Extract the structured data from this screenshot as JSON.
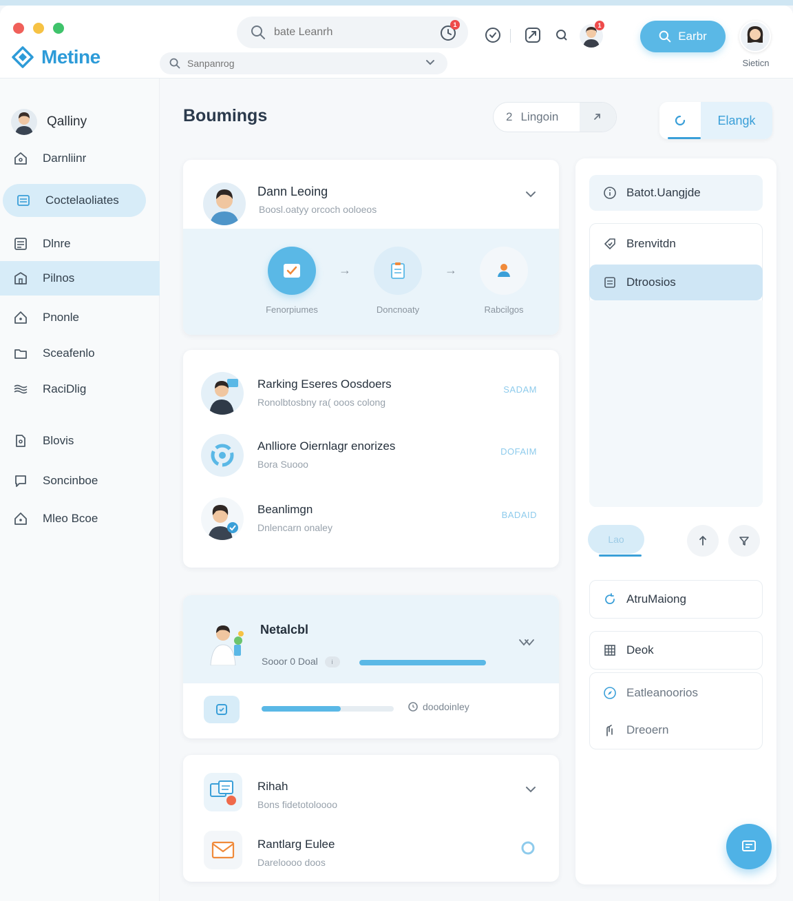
{
  "app": {
    "logo_text": "Metine",
    "accent": "#5ab8e6",
    "accent_dark": "#3a9fd8"
  },
  "header": {
    "search_placeholder": "bate Leanrh",
    "sub_search_placeholder": "Sanpanrog",
    "notification_count": "1",
    "avatar_badge_count": "1",
    "search_button_label": "Earbr",
    "user_name": "Sieticn"
  },
  "sidebar": {
    "profile_name": "Qalliny",
    "items": [
      {
        "label": "Darnliinr",
        "icon": "home-icon"
      },
      {
        "label": "Coctelaoliates",
        "icon": "list-icon"
      },
      {
        "label": "Dlnre",
        "icon": "document-icon"
      },
      {
        "label": "Pilnos",
        "icon": "building-icon"
      },
      {
        "label": "Pnonle",
        "icon": "house-icon"
      },
      {
        "label": "Sceafenlo",
        "icon": "folder-icon"
      },
      {
        "label": "RaciDlig",
        "icon": "waves-icon"
      },
      {
        "label": "Blovis",
        "icon": "file-icon"
      },
      {
        "label": "Soncinboe",
        "icon": "chat-icon"
      },
      {
        "label": "Mleo Bcoe",
        "icon": "house-icon"
      }
    ]
  },
  "main": {
    "title": "Boumings",
    "segment": {
      "count": "2",
      "label": "Lingoin"
    },
    "tab_toggle_label": "Elangk",
    "profile_card": {
      "title": "Dann Leoing",
      "subtitle": "Boosl.oatyy orcoch ooloeos",
      "steps": [
        {
          "label": "Fenorpiumes"
        },
        {
          "label": "Doncnoaty"
        },
        {
          "label": "Rabcilgos"
        }
      ]
    },
    "list_card": {
      "rows": [
        {
          "title": "Rarking Eseres Oosdoers",
          "subtitle": "Ronolbtosbny ra( ooos colong",
          "tag": "SADAM"
        },
        {
          "title": "Anlliore Oiernlagr enorizes",
          "subtitle": "Bora Suooo",
          "tag": "DOFAIM"
        },
        {
          "title": "Beanlimgn",
          "subtitle": "Dnlencarn onaley",
          "tag": "BADAID"
        }
      ]
    },
    "progress_card": {
      "title": "Netalcbl",
      "status": "Sooor 0 Doal",
      "status_chip": "i",
      "progress_top": 1.0,
      "progress_bottom": 0.6,
      "meta": "doodoinley"
    },
    "bottom_card": {
      "rows": [
        {
          "title": "Rihah",
          "subtitle": "Bons fidetotoloooo"
        },
        {
          "title": "Rantlarg Eulee",
          "subtitle": "Dareloooo doos"
        }
      ]
    }
  },
  "right_panel": {
    "header_item": "Batot.Uangjde",
    "items": [
      {
        "label": "Brenvitdn",
        "icon": "tag-icon"
      },
      {
        "label": "Dtroosios",
        "icon": "document-icon"
      }
    ],
    "pill_label": "Lao",
    "lower_items": [
      {
        "label": "AtruMaiong",
        "icon": "refresh-icon"
      },
      {
        "label": "Deok",
        "icon": "grid-icon"
      },
      {
        "label": "Eatleanoorios",
        "icon": "compass-icon"
      },
      {
        "label": "Dreoern",
        "icon": "hand-icon"
      }
    ]
  }
}
